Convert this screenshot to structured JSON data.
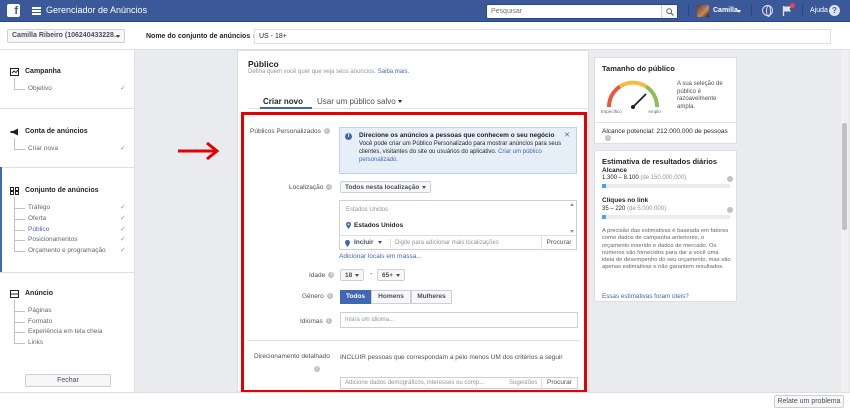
{
  "topbar": {
    "logo": "f",
    "app_title": "Gerenciador de Anúncios",
    "search_placeholder": "Pesquisar",
    "user_name": "Camilla",
    "help_label": "Ajuda"
  },
  "subheader": {
    "account": "Camilla Ribeiro (106240433228...",
    "adset_label": "Nome do conjunto de anúncios",
    "adset_value": "US - 18+"
  },
  "sidebar": {
    "campaign": {
      "title": "Campanha",
      "items": [
        "Objetivo"
      ]
    },
    "account": {
      "title": "Conta de anúncios",
      "items": [
        "Criar nova"
      ]
    },
    "adset": {
      "title": "Conjunto de anúncios",
      "items": [
        "Tráfego",
        "Oferta",
        "Público",
        "Posicionamentos",
        "Orçamento e programação"
      ],
      "active_index": 2
    },
    "ad": {
      "title": "Anúncio",
      "items": [
        "Páginas",
        "Formato",
        "Experiência em tela cheia",
        "Links"
      ]
    },
    "close_label": "Fechar"
  },
  "audience": {
    "title": "Público",
    "subtitle": "Defina quem você quer que veja seus anúncios.",
    "subtitle_link": "Saiba mais.",
    "tabs": [
      "Criar novo",
      "Usar um público salvo"
    ],
    "custom_label": "Públicos Personalizados",
    "info_title": "Direcione os anúncios a pessoas que conhecem o seu negócio",
    "info_text": "Você pode criar um Público Personalizado para mostrar anúncios para seus clientes, visitantes do site ou usuários do aplicativo.",
    "info_link": "Criar um público personalizado.",
    "location_label": "Localização",
    "location_dropdown": "Todos nesta localização",
    "location_placeholder": "Estados Unidos",
    "location_selected": "Estados Unidos",
    "include_label": "Incluir",
    "location_input_placeholder": "Digite para adicionar mais localizações",
    "search_label": "Procurar",
    "bulk_link": "Adicionar locais em massa...",
    "age_label": "Idade",
    "age_min": "18",
    "age_max": "65+",
    "age_sep": "-",
    "gender_label": "Gênero",
    "genders": [
      "Todos",
      "Homens",
      "Mulheres"
    ],
    "gender_selected": 0,
    "lang_label": "Idiomas",
    "lang_placeholder": "Insira um idioma...",
    "detailed_label": "Direcionamento detalhado",
    "detailed_text": "INCLUIR pessoas que correspondam a pelo menos UM dos critérios a seguir",
    "detailed_placeholder": "Adicione dados demográficos, interesses ou comp...",
    "suggestions_label": "Sugestões",
    "search_label2": "Procurar"
  },
  "audience_size": {
    "title": "Tamanho do público",
    "gauge_left": "Específico",
    "gauge_right": "Amplo",
    "description": "A sua seleção de público é razoavelmente ampla.",
    "reach_label": "Alcance potencial: 212.000.000 de pessoas",
    "gauge_colors": [
      "#e9573f",
      "#f6bb42",
      "#8cc152"
    ]
  },
  "estimates": {
    "title": "Estimativa de resultados diários",
    "reach_title": "Alcance",
    "reach_value": "1.300 – 8.100",
    "reach_of": "(de 150.000.000)",
    "clicks_title": "Cliques no link",
    "clicks_value": "35 – 220",
    "clicks_of": "(de 5.000.000)",
    "disclaimer": "A precisão das estimativas é baseada em fatores como dados de campanha anteriores, o orçamento inserido e dados de mercado. Os números são fornecidos para dar a você uma ideia de desempenho do seu orçamento, mas são apenas estimativas e não garantem resultados.",
    "feedback_link": "Essas estimativas foram úteis?"
  },
  "footer": {
    "report_label": "Relate um problema"
  },
  "colors": {
    "brand": "#3b5998",
    "accent": "#4267b2",
    "highlight_frame": "#e30000"
  }
}
